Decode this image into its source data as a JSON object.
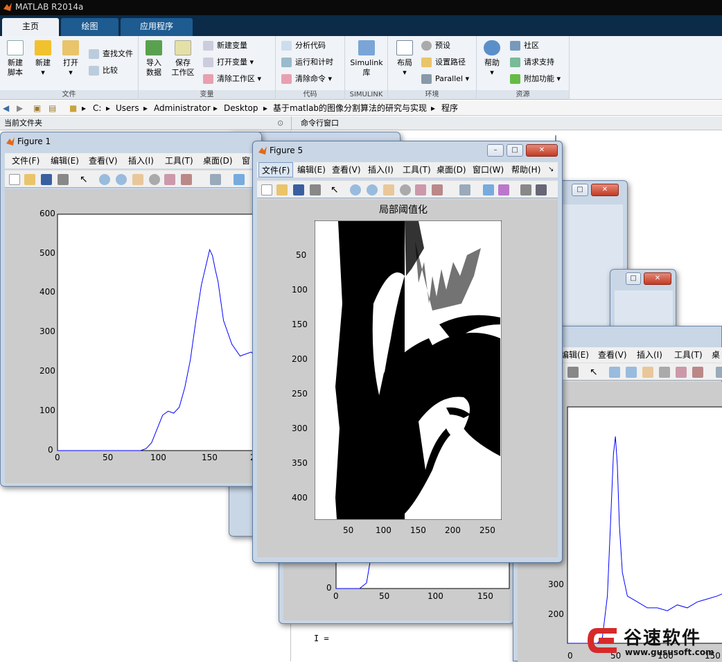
{
  "app": {
    "title": "MATLAB R2014a"
  },
  "tabs": [
    "主页",
    "绘图",
    "应用程序"
  ],
  "ribbon": {
    "file": {
      "label": "文件",
      "new_script": [
        "新建",
        "脚本"
      ],
      "new": "新建",
      "open": "打开",
      "find_files": "查找文件",
      "compare": "比较"
    },
    "variable": {
      "label": "变量",
      "import": [
        "导入",
        "数据"
      ],
      "save": [
        "保存",
        "工作区"
      ],
      "new_var": "新建变量",
      "open_var": "打开变量",
      "clear_ws": "清除工作区"
    },
    "code": {
      "label": "代码",
      "analyze": "分析代码",
      "run_time": "运行和计时",
      "clear_cmd": "清除命令"
    },
    "simulink": {
      "label": "SIMULINK",
      "btn": [
        "Simulink",
        "库"
      ]
    },
    "env": {
      "label": "环境",
      "layout": "布局",
      "prefs": "预设",
      "set_path": "设置路径",
      "parallel": "Parallel"
    },
    "resources": {
      "label": "资源",
      "help": "帮助",
      "community": "社区",
      "support": "请求支持",
      "addons": "附加功能"
    }
  },
  "address": {
    "crumbs": [
      "C:",
      "Users",
      "Administrator",
      "Desktop",
      "基于matlab的图像分割算法的研究与实现",
      "程序"
    ]
  },
  "panes": {
    "current_folder": "当前文件夹",
    "command_window": "命令行窗口"
  },
  "figure1": {
    "title": "Figure 1",
    "menu": [
      "文件(F)",
      "编辑(E)",
      "查看(V)",
      "插入(I)",
      "工具(T)",
      "桌面(D)",
      "窗"
    ],
    "yticks": [
      "600",
      "500",
      "400",
      "300",
      "200",
      "100",
      "0"
    ],
    "xticks": [
      "0",
      "50",
      "100",
      "150",
      "2"
    ]
  },
  "figure5": {
    "title": "Figure 5",
    "menu": [
      "文件(F)",
      "编辑(E)",
      "查看(V)",
      "插入(I)",
      "工具(T)",
      "桌面(D)",
      "窗口(W)",
      "帮助(H)"
    ],
    "axes_title": "局部阈值化",
    "yticks": [
      "50",
      "100",
      "150",
      "200",
      "250",
      "300",
      "350",
      "400"
    ],
    "xticks": [
      "50",
      "100",
      "150",
      "200",
      "250"
    ]
  },
  "figure_right": {
    "menu": [
      "编辑(E)",
      "查看(V)",
      "插入(I)",
      "工具(T)",
      "桌面"
    ],
    "yticks": [
      "300",
      "200",
      "100",
      "0"
    ],
    "xticks": [
      "0",
      "50",
      "100",
      "150"
    ]
  },
  "figure_back": {
    "yticks": [
      "0"
    ],
    "xticks": [
      "0",
      "50",
      "100",
      "150"
    ]
  },
  "command": {
    "text": "I ="
  },
  "watermark": {
    "name": "谷速软件",
    "url": "www.gususoft.com"
  },
  "chart_data": [
    {
      "type": "line",
      "title": "",
      "xlim": [
        0,
        255
      ],
      "ylim": [
        0,
        600
      ],
      "series": [
        {
          "x": [
            0,
            60,
            64,
            68,
            72,
            76,
            80,
            84,
            88,
            92,
            96,
            100,
            104,
            108,
            110,
            112,
            114,
            116,
            120,
            126,
            132,
            140,
            146,
            150,
            156,
            160,
            164,
            168,
            172,
            176,
            180,
            186,
            190
          ],
          "values": [
            0,
            0,
            5,
            20,
            55,
            90,
            100,
            95,
            110,
            160,
            230,
            330,
            420,
            480,
            510,
            495,
            460,
            430,
            330,
            270,
            240,
            250,
            230,
            210,
            160,
            100,
            75,
            70,
            90,
            150,
            220,
            290,
            250
          ]
        }
      ]
    },
    {
      "type": "line",
      "title": "",
      "xlim": [
        0,
        160
      ],
      "ylim": [
        0,
        400
      ],
      "series": [
        {
          "x": [
            0,
            30,
            35,
            40,
            43,
            46,
            48,
            50,
            52,
            55,
            60,
            70,
            80,
            90,
            100,
            110,
            120,
            130,
            140,
            150,
            160
          ],
          "values": [
            0,
            0,
            10,
            80,
            200,
            320,
            350,
            300,
            200,
            120,
            80,
            70,
            60,
            60,
            55,
            65,
            60,
            70,
            75,
            80,
            85
          ]
        }
      ]
    }
  ]
}
